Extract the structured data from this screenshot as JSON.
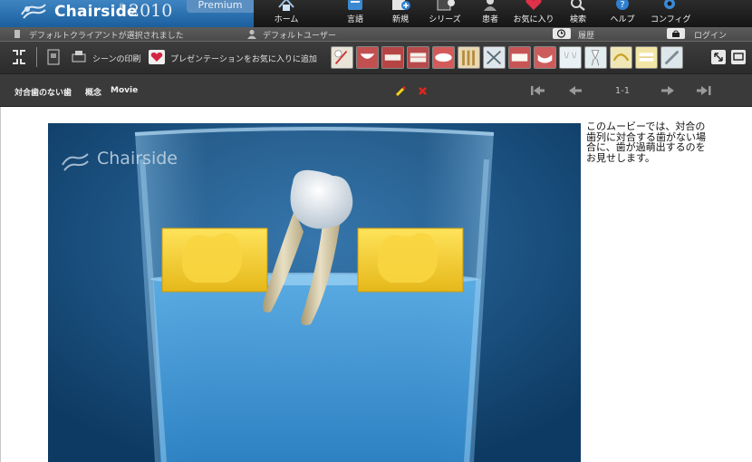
{
  "app": {
    "name": "Chairside",
    "trademark": "®",
    "year": "2010",
    "edition": "Premium"
  },
  "nav": [
    {
      "label": "ホーム",
      "icon": "home-icon"
    },
    {
      "label": "言語",
      "icon": "language-icon"
    },
    {
      "label": "新規",
      "icon": "new-icon"
    },
    {
      "label": "シリーズ",
      "icon": "series-icon"
    },
    {
      "label": "患者",
      "icon": "patient-icon"
    },
    {
      "label": "お気に入り",
      "icon": "favorites-icon"
    },
    {
      "label": "検索",
      "icon": "search-icon"
    },
    {
      "label": "ヘルプ",
      "icon": "help-icon"
    },
    {
      "label": "コンフィグ",
      "icon": "config-icon"
    }
  ],
  "status": {
    "client": "デフォルトクライアントが選択されました",
    "user": "デフォルトユーザー",
    "history": "履歴",
    "login": "ログイン"
  },
  "toolbar": {
    "print_scene": "シーンの印刷",
    "add_favorite": "プレゼンテーションをお気に入りに追加"
  },
  "scene": {
    "title": "対合歯のない歯",
    "concept": "概念",
    "type": "Movie",
    "counter": "1-1"
  },
  "video": {
    "watermark": "Chairside"
  },
  "description": "このムービーでは、対合の歯列に対合する歯がない場合に、歯が過萌出するのをお見せします。",
  "colors": {
    "brand_blue": "#2a6fae",
    "accent_yellow": "#f5d21a",
    "delete_red": "#e0261e",
    "water_blue": "#3f95d6"
  }
}
